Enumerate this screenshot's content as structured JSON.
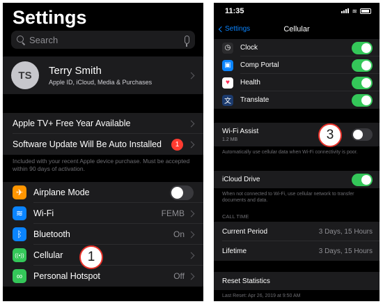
{
  "left": {
    "title": "Settings",
    "search_placeholder": "Search",
    "profile": {
      "initials": "TS",
      "name": "Terry Smith",
      "subtitle": "Apple ID, iCloud, Media & Purchases"
    },
    "offers": [
      {
        "label": "Apple TV+ Free Year Available"
      },
      {
        "label": "Software Update Will Be Auto Installed",
        "badge": "1"
      }
    ],
    "note": "Included with your recent Apple device purchase. Must be accepted within 90 days of activation.",
    "settings": [
      {
        "label": "Airplane Mode",
        "icon": "airplane-icon",
        "color": "#ff9500",
        "glyph": "✈",
        "value": "",
        "toggle": "off"
      },
      {
        "label": "Wi-Fi",
        "icon": "wifi-icon",
        "color": "#0a84ff",
        "glyph": "≋",
        "value": "FEMB"
      },
      {
        "label": "Bluetooth",
        "icon": "bluetooth-icon",
        "color": "#0a84ff",
        "glyph": "ᛒ",
        "value": "On"
      },
      {
        "label": "Cellular",
        "icon": "cellular-icon",
        "color": "#34c759",
        "glyph": "((•))",
        "value": ""
      },
      {
        "label": "Personal Hotspot",
        "icon": "hotspot-icon",
        "color": "#34c759",
        "glyph": "∞",
        "value": "Off"
      }
    ],
    "callout": "1"
  },
  "right": {
    "time": "11:35",
    "back_label": "Settings",
    "nav_title": "Cellular",
    "apps": [
      {
        "label": "Clock",
        "icon": "clock-icon",
        "color": "#2c2c2e",
        "glyph": "◷",
        "toggle": "on"
      },
      {
        "label": "Comp Portal",
        "icon": "comp-portal-icon",
        "color": "#0a84ff",
        "glyph": "▣",
        "toggle": "on"
      },
      {
        "label": "Health",
        "icon": "health-icon",
        "color": "#ffffff",
        "glyph": "♥",
        "toggle": "on"
      },
      {
        "label": "Translate",
        "icon": "translate-icon",
        "color": "#1c3b6e",
        "glyph": "文",
        "toggle": "on"
      }
    ],
    "wifi_assist": {
      "label": "Wi-Fi Assist",
      "sub": "1.2 MB",
      "toggle": "off"
    },
    "wifi_assist_note": "Automatically use cellular data when Wi-Fi connectivity is poor.",
    "icloud_drive": {
      "label": "iCloud Drive",
      "toggle": "on"
    },
    "icloud_note": "When not connected to Wi-Fi, use cellular network to transfer documents and data.",
    "call_time_header": "CALL TIME",
    "call_time": [
      {
        "label": "Current Period",
        "value": "3 Days, 15 Hours"
      },
      {
        "label": "Lifetime",
        "value": "3 Days, 15 Hours"
      }
    ],
    "reset_label": "Reset Statistics",
    "last_reset": "Last Reset: Apr 26, 2019 at 9:50 AM",
    "callout": "3"
  }
}
